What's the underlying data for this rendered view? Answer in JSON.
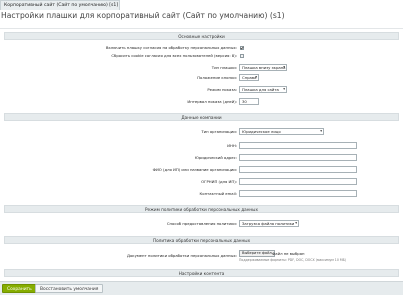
{
  "tab": {
    "label": "Корпоративный сайт (Сайт по умолчанию) [s1]"
  },
  "page": {
    "title": "Настройки плашки для корпоративный сайт (Сайт по умолчанию) (s1)"
  },
  "sections": {
    "main": "Основные настройки",
    "company": "Данные компании",
    "policy_mode": "Режим политики обработки персональных данных",
    "policy": "Политика обработки персональных данных",
    "contacts": "Настройки контента"
  },
  "main_settings": {
    "enable_consent_label": "Включить плашку согласия на обработку персональных данных:",
    "enable_consent_checked": true,
    "reset_cookie_label": "Сбросить cookie согласия для всех пользователей (версия: 8):",
    "reset_cookie_checked": false,
    "banner_type_label": "Тип плашки:",
    "banner_type_value": "Плашка внизу экрана",
    "button_position_label": "Положение кнопки:",
    "button_position_value": "Справа",
    "display_mode_label": "Режим показа:",
    "display_mode_value": "Плашка для сайта",
    "interval_label": "Интервал показа (дней):",
    "interval_value": "30"
  },
  "company": {
    "org_type_label": "Тип организации:",
    "org_type_value": "Юридическое лицо",
    "inn_label": "ИНН:",
    "inn_value": "",
    "legal_address_label": "Юридический адрес:",
    "legal_address_value": "",
    "name_label": "ФИО (для ИП) или название организации:",
    "name_value": "",
    "ogrn_label": "ОГРНИП (для ИП):",
    "ogrn_value": "",
    "email_label": "Контактный email:",
    "email_value": ""
  },
  "policy_mode": {
    "method_label": "Способ предоставления политики:",
    "method_value": "Загрузка файла политики"
  },
  "policy": {
    "document_label": "Документ политики обработки персональных данных:",
    "choose_file_label": "Выберите файл",
    "file_status": "Файл не выбран",
    "formats_note": "Поддерживаемые форматы: PDF, DOC, DOCX (максимум 10 МБ)"
  },
  "footer": {
    "save_label": "Сохранить",
    "reset_label": "Восстановить умолчания"
  },
  "colors": {
    "save_button": "#86ad00",
    "section_header": "#e6ebed"
  }
}
